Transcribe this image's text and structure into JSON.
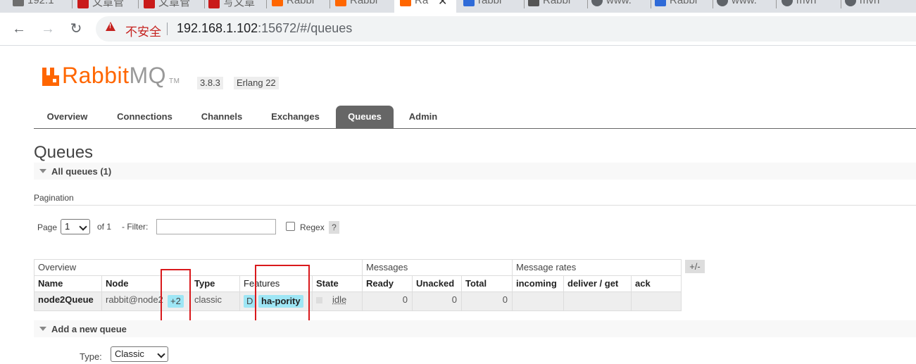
{
  "browser": {
    "tabs": [
      {
        "label": "192.1",
        "icon": "cube-icon",
        "color": "#6e6e6e"
      },
      {
        "label": "文章管",
        "icon": "csdn-icon",
        "color": "#c91a1a"
      },
      {
        "label": "文章管",
        "icon": "csdn-icon",
        "color": "#c91a1a"
      },
      {
        "label": "写文章",
        "icon": "csdn-icon",
        "color": "#c91a1a"
      },
      {
        "label": "Rabbi",
        "icon": "rabbitmq-icon",
        "color": "#ff6600"
      },
      {
        "label": "Rabbi",
        "icon": "rabbitmq-icon",
        "color": "#ff6600"
      },
      {
        "label": "Ra",
        "icon": "rabbitmq-icon",
        "color": "#ff6600"
      },
      {
        "label": "rabbi",
        "icon": "baidu-icon",
        "color": "#2f6bd8"
      },
      {
        "label": "Rabbi",
        "icon": "search-icon",
        "color": "#555555"
      },
      {
        "label": "www.",
        "icon": "globe-icon",
        "color": "#5f6368"
      },
      {
        "label": "Rabbi",
        "icon": "baidu-icon",
        "color": "#2f6bd8"
      },
      {
        "label": "www.",
        "icon": "globe-icon",
        "color": "#5f6368"
      },
      {
        "label": "mvn",
        "icon": "globe-icon",
        "color": "#5f6368"
      },
      {
        "label": "mvn",
        "icon": "globe-icon",
        "color": "#5f6368"
      }
    ],
    "security_label": "不安全",
    "url_host": "192.168.1.102",
    "url_rest": ":15672/#/queues"
  },
  "header": {
    "logo_rabbit": "Rabbit",
    "logo_mq": "MQ",
    "logo_tm": "TM",
    "version": "3.8.3",
    "erlang": "Erlang 22"
  },
  "nav": {
    "overview": "Overview",
    "connections": "Connections",
    "channels": "Channels",
    "exchanges": "Exchanges",
    "queues": "Queues",
    "admin": "Admin"
  },
  "page": {
    "title": "Queues",
    "all_queues": "All queues (1)",
    "pagination_label": "Pagination",
    "page_label": "Page",
    "page_value": "1",
    "of_label": "of 1",
    "filter_label": "- Filter:",
    "filter_value": "",
    "regex_label": "Regex",
    "help_label": "?",
    "add_queue": "Add a new queue",
    "type_label": "Type:",
    "type_value": "Classic"
  },
  "table": {
    "groups": {
      "overview": "Overview",
      "messages": "Messages",
      "rates": "Message rates"
    },
    "plusminus": "+/-",
    "headers": {
      "name": "Name",
      "node": "Node",
      "type": "Type",
      "features": "Features",
      "state": "State",
      "ready": "Ready",
      "unacked": "Unacked",
      "total": "Total",
      "incoming": "incoming",
      "deliver_get": "deliver / get",
      "ack": "ack"
    },
    "row": {
      "name": "node2Queue",
      "node": "rabbit@node2",
      "mirrors": "+2",
      "type": "classic",
      "feature_d": "D",
      "policy": "ha-pority",
      "state": "idle",
      "ready": "0",
      "unacked": "0",
      "total": "0"
    }
  }
}
